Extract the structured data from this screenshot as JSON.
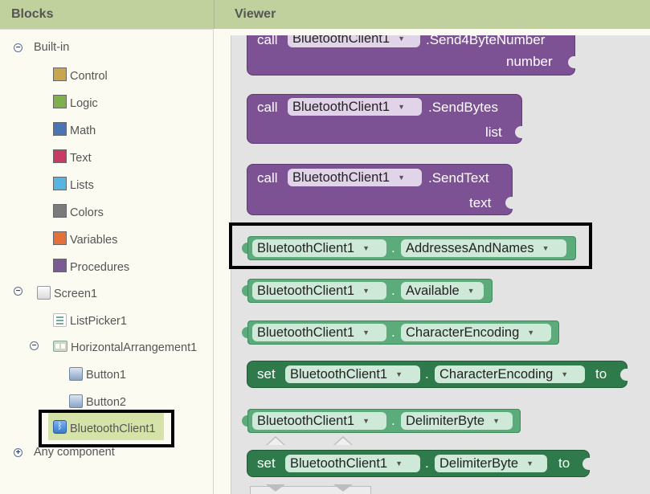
{
  "blocks_panel": {
    "title": "Blocks",
    "builtin": {
      "label": "Built-in",
      "toggle": "−",
      "items": [
        {
          "label": "Control",
          "color": "#c8a64e"
        },
        {
          "label": "Logic",
          "color": "#7eb04e"
        },
        {
          "label": "Math",
          "color": "#4a74b4"
        },
        {
          "label": "Text",
          "color": "#c93b64"
        },
        {
          "label": "Lists",
          "color": "#57b6df"
        },
        {
          "label": "Colors",
          "color": "#7b7b7b"
        },
        {
          "label": "Variables",
          "color": "#e4713b"
        },
        {
          "label": "Procedures",
          "color": "#7c5a93"
        }
      ]
    },
    "screen": {
      "label": "Screen1",
      "toggle": "−",
      "listpicker": "ListPicker1",
      "harr": {
        "label": "HorizontalArrangement1",
        "toggle": "−"
      },
      "button1": "Button1",
      "button2": "Button2",
      "bluetooth": "BluetoothClient1",
      "bt_icon": "ᛒ"
    },
    "any": {
      "label": "Any component",
      "toggle": "+"
    }
  },
  "viewer": {
    "title": "Viewer",
    "blocks": {
      "send4": {
        "call": "call",
        "component": "BluetoothClient1",
        "method": ".Send4ByteNumber",
        "param": "number"
      },
      "sendbytes": {
        "call": "call",
        "component": "BluetoothClient1",
        "method": ".SendBytes",
        "param": "list"
      },
      "sendtext": {
        "call": "call",
        "component": "BluetoothClient1",
        "method": ".SendText",
        "param": "text"
      },
      "addr": {
        "component": "BluetoothClient1",
        "dot": ".",
        "property": "AddressesAndNames"
      },
      "avail": {
        "component": "BluetoothClient1",
        "dot": ".",
        "property": "Available"
      },
      "charenc": {
        "component": "BluetoothClient1",
        "dot": ".",
        "property": "CharacterEncoding"
      },
      "set_charenc": {
        "set": "set",
        "component": "BluetoothClient1",
        "dot": ".",
        "property": "CharacterEncoding",
        "to": "to"
      },
      "delim": {
        "component": "BluetoothClient1",
        "dot": ".",
        "property": "DelimiterByte"
      },
      "set_delim": {
        "set": "set",
        "component": "BluetoothClient1",
        "dot": ".",
        "property": "DelimiterByte",
        "to": "to"
      }
    },
    "dropdown_arrow": "▼"
  }
}
